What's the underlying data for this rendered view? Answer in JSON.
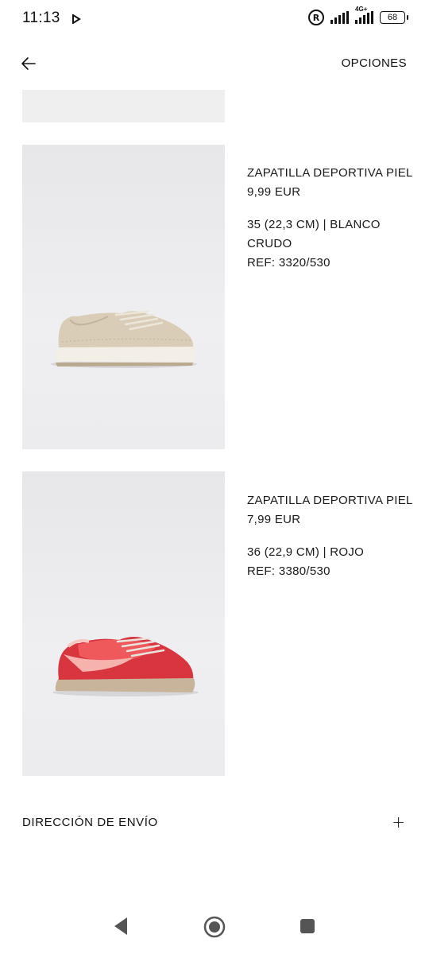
{
  "status_bar": {
    "time": "11:13",
    "network": "4G+",
    "battery": "68"
  },
  "header": {
    "options_label": "OPCIONES"
  },
  "products": [
    {
      "name": "ZAPATILLA DEPORTIVA PIEL",
      "price": "9,99 EUR",
      "size_color_line1": "35 (22,3 CM) | BLANCO",
      "size_color_line2": "CRUDO",
      "ref": "REF: 3320/530",
      "shoe_color": "#d9cbb5"
    },
    {
      "name": "ZAPATILLA DEPORTIVA PIEL",
      "price": "7,99 EUR",
      "size_color_line1": "36 (22,9 CM) | ROJO",
      "ref": "REF: 3380/530",
      "shoe_color": "#d8353f"
    }
  ],
  "shipping": {
    "label": "DIRECCIÓN DE ENVÍO",
    "expand_symbol": "+"
  }
}
